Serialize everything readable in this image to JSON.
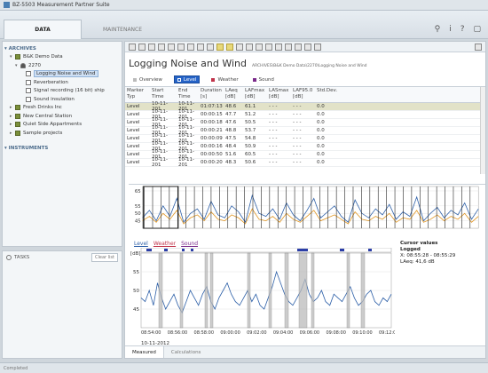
{
  "app": {
    "title": "BZ-5503 Measurement Partner Suite"
  },
  "tabs": {
    "data": "DATA",
    "maintenance": "MAINTENANCE"
  },
  "top_icons": {
    "user": "⚲",
    "info": "i",
    "help": "?",
    "window": "▢"
  },
  "sidebar": {
    "archives_label": "▾ ARCHIVES",
    "tree": [
      {
        "label": "B&K Demo Data",
        "twisty": "▾",
        "icon": "folder",
        "indent": 1
      },
      {
        "label": "2270",
        "twisty": "▾",
        "icon": "person",
        "indent": 2
      },
      {
        "label": "Logging Noise and Wind",
        "twisty": "",
        "icon": "file",
        "indent": 3,
        "selected": true
      },
      {
        "label": "Reverberation",
        "twisty": "",
        "icon": "file",
        "indent": 3
      },
      {
        "label": "Signal recording (16 bit) ship",
        "twisty": "",
        "icon": "file",
        "indent": 3
      },
      {
        "label": "Sound insulation",
        "twisty": "",
        "icon": "file",
        "indent": 3
      },
      {
        "label": "Fresh Drinks Inc",
        "twisty": "▸",
        "icon": "folder",
        "indent": 1
      },
      {
        "label": "New Central Station",
        "twisty": "▸",
        "icon": "folder",
        "indent": 1
      },
      {
        "label": "Quiet Side Appartments",
        "twisty": "▸",
        "icon": "folder",
        "indent": 1
      },
      {
        "label": "Sample projects",
        "twisty": "▸",
        "icon": "folder",
        "indent": 1
      }
    ],
    "instruments_label": "▾ INSTRUMENTS"
  },
  "tasks": {
    "label": "TASKS",
    "clear": "Clear list"
  },
  "main": {
    "title": "Logging Noise and Wind",
    "path": "ARCHIVES\\B&K Demo Data\\2270\\Logging Noise and Wind",
    "view_tabs": [
      {
        "label": "Overview",
        "color": "#bbbbbb",
        "active": false
      },
      {
        "label": "Level",
        "color": "#2563c7",
        "active": true
      },
      {
        "label": "Weather",
        "color": "#c0334a",
        "active": false
      },
      {
        "label": "Sound",
        "color": "#7a2a8a",
        "active": false
      }
    ],
    "table": {
      "columns": [
        [
          "Marker Typ",
          ""
        ],
        [
          "Start Time",
          ""
        ],
        [
          "End Time",
          ""
        ],
        [
          "Duration",
          "[s]"
        ],
        [
          "LAeq",
          "[dB]"
        ],
        [
          "LAFmax",
          "[dB]"
        ],
        [
          "LASmax",
          "[dB]"
        ],
        [
          "LAF95.0",
          "[dB]"
        ],
        [
          "Std.Dev.",
          ""
        ]
      ],
      "rows": [
        [
          "Level",
          "10-11-201",
          "10-11-201",
          "01:07:13",
          "48.6",
          "61.1",
          "- - -",
          "- - -",
          "0.0"
        ],
        [
          "Level",
          "10-11-201",
          "10-11-201",
          "00:00:15",
          "47.7",
          "51.2",
          "- - -",
          "- - -",
          "0.0"
        ],
        [
          "Level",
          "10-11-201",
          "10-11-201",
          "00:00:18",
          "47.6",
          "50.5",
          "- - -",
          "- - -",
          "0.0"
        ],
        [
          "Level",
          "10-11-201",
          "10-11-201",
          "00:00:21",
          "48.8",
          "53.7",
          "- - -",
          "- - -",
          "0.0"
        ],
        [
          "Level",
          "10-11-201",
          "10-11-201",
          "00:00:09",
          "47.5",
          "54.8",
          "- - -",
          "- - -",
          "0.0"
        ],
        [
          "Level",
          "10-11-201",
          "10-11-201",
          "00:00:16",
          "48.4",
          "50.9",
          "- - -",
          "- - -",
          "0.0"
        ],
        [
          "Level",
          "10-11-201",
          "10-11-201",
          "00:00:50",
          "51.6",
          "60.5",
          "- - -",
          "- - -",
          "0.0"
        ],
        [
          "Level",
          "10-11-201",
          "10-11-201",
          "00:00:20",
          "48.3",
          "50.6",
          "- - -",
          "- - -",
          "0.0"
        ]
      ]
    },
    "legend": {
      "level": "Level",
      "weather": "Weather",
      "sound": "Sound"
    },
    "cursor": {
      "title": "Cursor values",
      "subtitle": "Logged",
      "x": "X: 08:55:28 - 08:55:29",
      "laeq": "LAeq: 41,6 dB"
    },
    "bottom_tabs": {
      "measured": "Measured",
      "calculations": "Calculations"
    }
  },
  "chart_data": [
    {
      "type": "line",
      "title": "",
      "ylabel": "",
      "yticks": [
        "65",
        "55",
        "50",
        "45"
      ],
      "ylim": [
        40,
        68
      ],
      "series": [
        {
          "color": "#2b5ea7",
          "values": [
            47,
            52,
            45,
            55,
            48,
            60,
            44,
            50,
            53,
            46,
            58,
            49,
            47,
            55,
            51,
            44,
            62,
            50,
            48,
            53,
            46,
            57,
            49,
            45,
            52,
            60,
            47,
            51,
            55,
            48,
            44,
            59,
            50,
            47,
            53,
            49,
            56,
            46,
            51,
            48,
            61,
            45,
            50,
            54,
            47,
            52,
            49,
            57,
            46,
            53
          ]
        },
        {
          "color": "#e0941e",
          "values": [
            45,
            48,
            44,
            50,
            46,
            52,
            43,
            47,
            49,
            45,
            51,
            46,
            45,
            49,
            47,
            43,
            53,
            46,
            45,
            48,
            44,
            50,
            46,
            44,
            48,
            52,
            45,
            47,
            49,
            46,
            43,
            51,
            46,
            45,
            48,
            46,
            50,
            44,
            47,
            46,
            52,
            44,
            46,
            49,
            45,
            48,
            46,
            50,
            44,
            48
          ]
        }
      ]
    },
    {
      "type": "line",
      "title": "",
      "ylabel": "[dB]",
      "xlabel": "10-11-2012",
      "yticks": [
        "55",
        "50",
        "45"
      ],
      "xticks": [
        "08:54:00",
        "08:56:00",
        "08:58:00",
        "09:00:00",
        "09:02:00",
        "09:04:00",
        "09:06:00",
        "09:08:00",
        "09:10:00",
        "09:12:00"
      ],
      "ylim": [
        40,
        60
      ],
      "series": [
        {
          "color": "#2b5ea7",
          "values": [
            48,
            47,
            50,
            46,
            52,
            48,
            45,
            47,
            49,
            46,
            44,
            47,
            50,
            48,
            46,
            49,
            51,
            47,
            45,
            48,
            50,
            52,
            49,
            47,
            46,
            48,
            50,
            47,
            49,
            46,
            45,
            48,
            51,
            55,
            52,
            49,
            47,
            46,
            48,
            50,
            53,
            49,
            47,
            48,
            50,
            47,
            46,
            49,
            48,
            47,
            49,
            51,
            48,
            46,
            47,
            49,
            50,
            47,
            46,
            48,
            47,
            49
          ]
        }
      ]
    }
  ]
}
